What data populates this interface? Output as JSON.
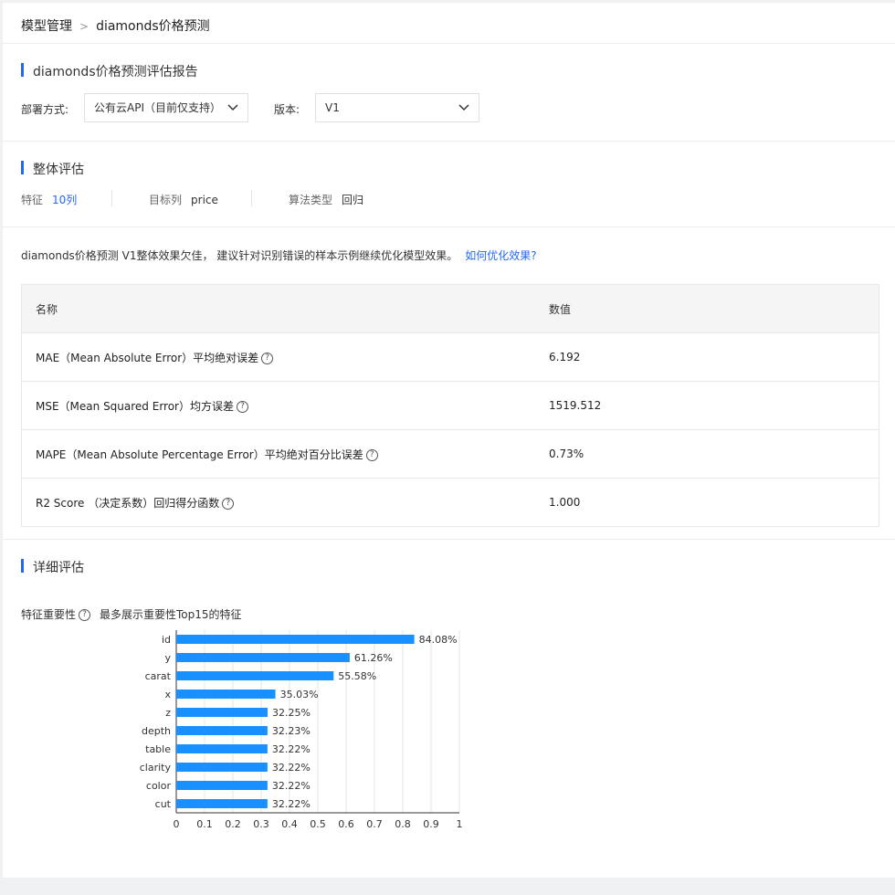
{
  "breadcrumb": {
    "parent": "模型管理",
    "separator": ">",
    "current": "diamonds价格预测"
  },
  "report": {
    "title": "diamonds价格预测评估报告",
    "deploy_label": "部署方式:",
    "deploy_value": "公有云API（目前仅支持）",
    "version_label": "版本:",
    "version_value": "V1"
  },
  "overall": {
    "title": "整体评估",
    "feature_key": "特征",
    "feature_value": "10列",
    "target_key": "目标列",
    "target_value": "price",
    "algo_key": "算法类型",
    "algo_value": "回归"
  },
  "advice": {
    "text": "diamonds价格预测 V1整体效果欠佳， 建议针对识别错误的样本示例继续优化模型效果。",
    "link": "如何优化效果?"
  },
  "metrics": {
    "headers": [
      "名称",
      "数值"
    ],
    "rows": [
      {
        "name": "MAE（Mean Absolute Error）平均绝对误差",
        "value": "6.192"
      },
      {
        "name": "MSE（Mean Squared Error）均方误差",
        "value": "1519.512"
      },
      {
        "name": "MAPE（Mean Absolute Percentage Error）平均绝对百分比误差",
        "value": "0.73%"
      },
      {
        "name": "R2 Score （决定系数）回归得分函数",
        "value": "1.000"
      }
    ]
  },
  "detail": {
    "title": "详细评估",
    "importance_label": "特征重要性",
    "importance_sub": "最多展示重要性Top15的特征"
  },
  "icons": {
    "help": "question-circle-icon",
    "chevron": "chevron-down-icon"
  },
  "colors": {
    "accent": "#2468f2",
    "bar": "#1890ff"
  },
  "chart_data": {
    "type": "bar",
    "orientation": "horizontal",
    "categories": [
      "id",
      "y",
      "carat",
      "x",
      "z",
      "depth",
      "table",
      "clarity",
      "color",
      "cut"
    ],
    "values": [
      0.8408,
      0.6126,
      0.5558,
      0.3503,
      0.3225,
      0.3223,
      0.3222,
      0.3222,
      0.3222,
      0.3222
    ],
    "labels": [
      "84.08%",
      "61.26%",
      "55.58%",
      "35.03%",
      "32.25%",
      "32.23%",
      "32.22%",
      "32.22%",
      "32.22%",
      "32.22%"
    ],
    "xticks": [
      "0",
      "0.1",
      "0.2",
      "0.3",
      "0.4",
      "0.5",
      "0.6",
      "0.7",
      "0.8",
      "0.9",
      "1"
    ],
    "xlim": [
      0,
      1
    ],
    "grid": true
  }
}
